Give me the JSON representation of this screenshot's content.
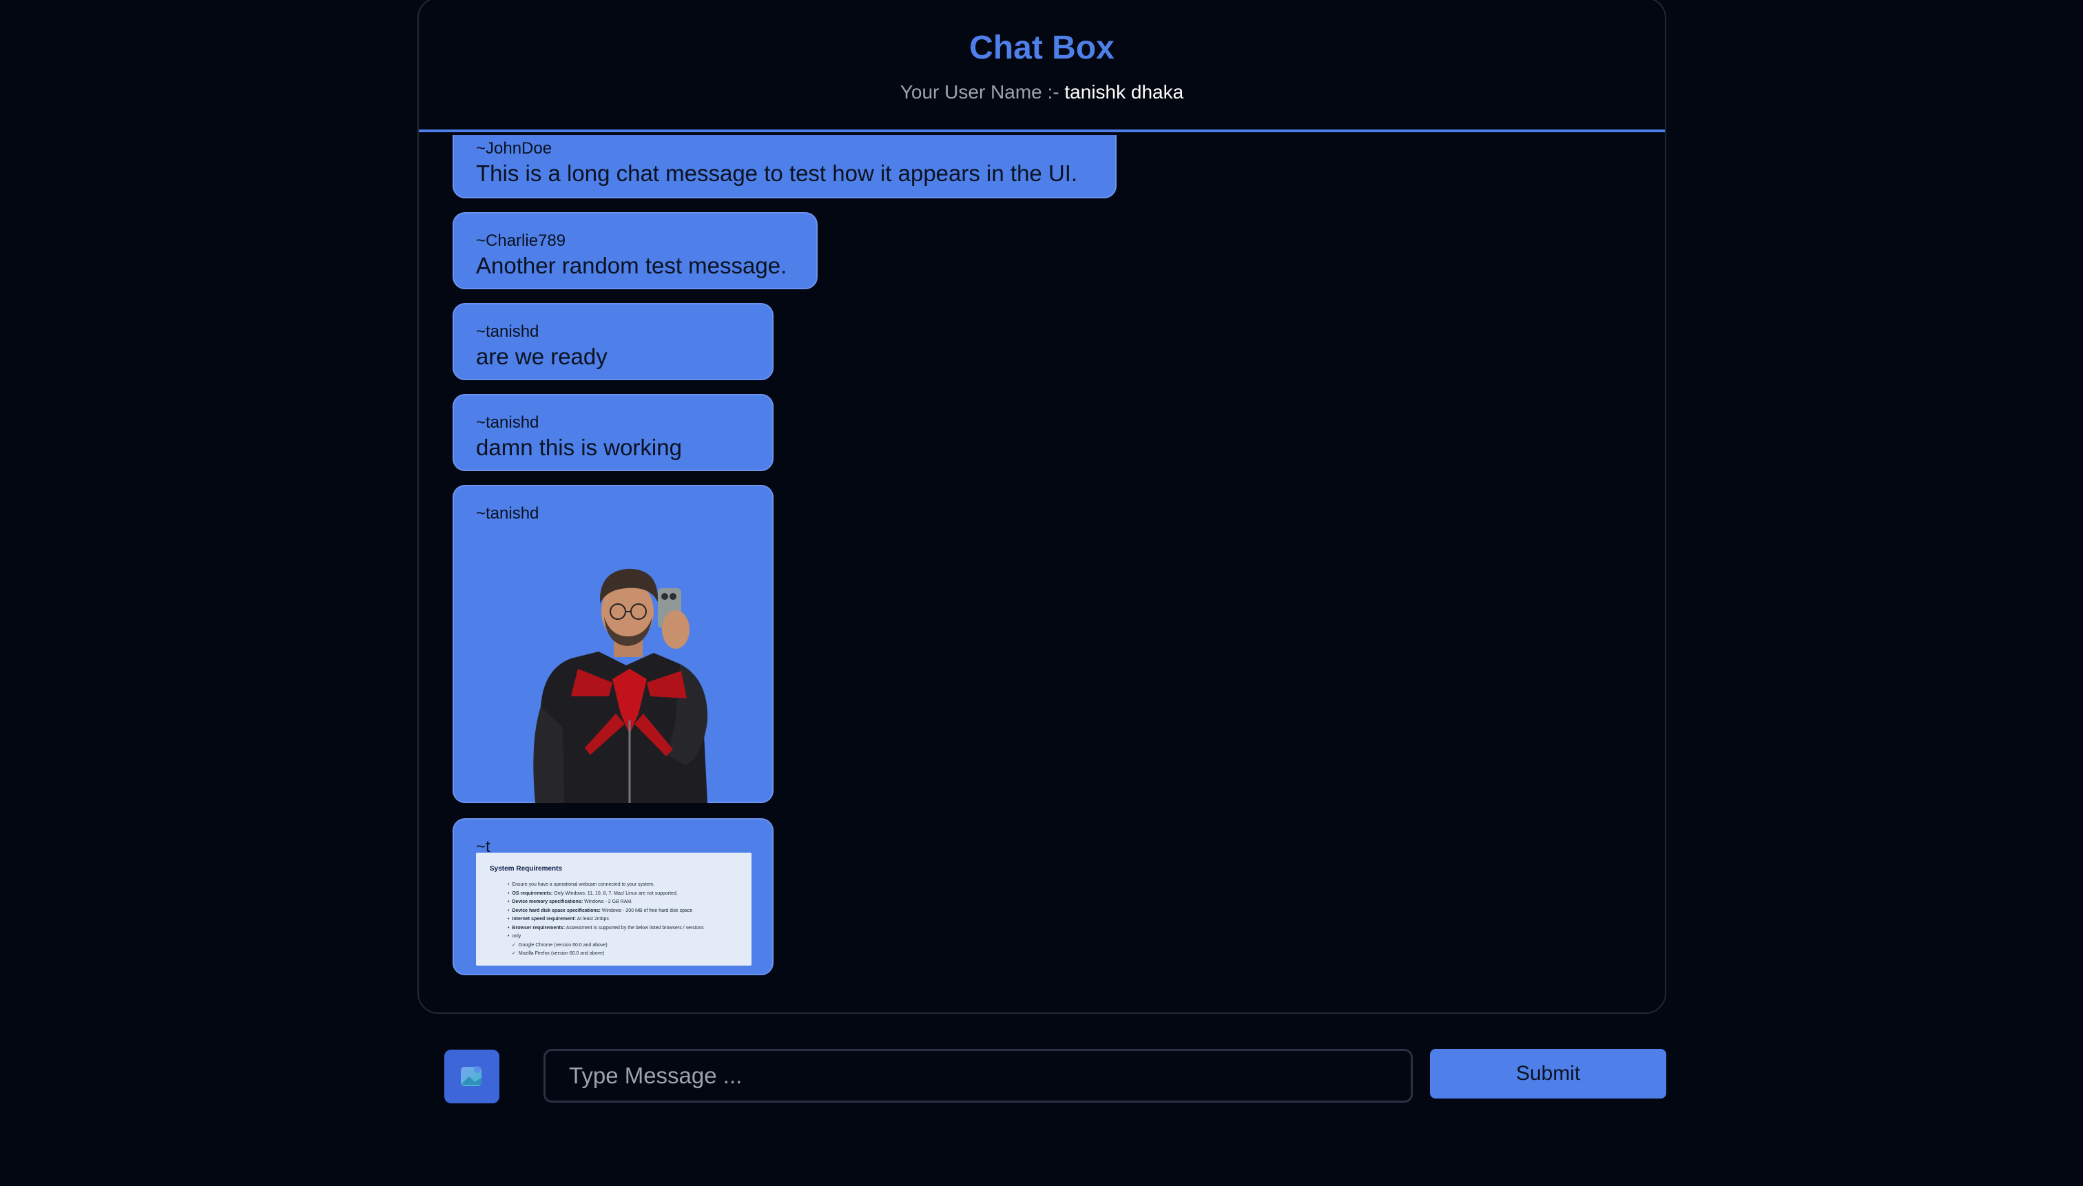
{
  "header": {
    "title": "Chat Box",
    "username_label": "Your User Name :-",
    "username_value": "tanishk dhaka"
  },
  "messages": [
    {
      "sender": "~JohnDoe",
      "text": "This is a long chat message to test how it appears in the UI."
    },
    {
      "sender": "~Charlie789",
      "text": "Another random test message."
    },
    {
      "sender": "~tanishd",
      "text": "are we ready"
    },
    {
      "sender": "~tanishd",
      "text": "damn this is working"
    },
    {
      "sender": "~tanishd",
      "attachment": "photo"
    },
    {
      "sender": "~t",
      "attachment": "document-screenshot"
    }
  ],
  "document_preview": {
    "title": "System Requirements",
    "items": [
      {
        "text": "Ensure you have a operational webcam connected to your system."
      },
      {
        "bold": "OS requirements:",
        "text": " Only Windows: 11, 10, 8, 7. Mac/ Linux are not supported."
      },
      {
        "bold": "Device memory specifications:",
        "text": " Windows - 2 GB RAM."
      },
      {
        "bold": "Device hard disk space specifications:",
        "text": " Windows - 200 MB of free hard disk space"
      },
      {
        "bold": "Internet speed requirement:",
        "text": " At least 2mbps"
      },
      {
        "bold": "Browser requirements:",
        "text": " Assessment is supported by the below listed browsers / versions"
      },
      {
        "text": "only"
      },
      {
        "text": "Google Chrome (version 60.0 and above)",
        "sub": true
      },
      {
        "text": "Mozilla Firefox (version 60.0 and above)",
        "sub": true
      }
    ]
  },
  "composer": {
    "placeholder": "Type Message ...",
    "submit_label": "Submit",
    "attach_icon": "image-icon"
  },
  "colors": {
    "background": "#030712",
    "accent": "#4f7fe8",
    "bubble": "#4f7fe8",
    "attach_button": "#3d67d9"
  }
}
